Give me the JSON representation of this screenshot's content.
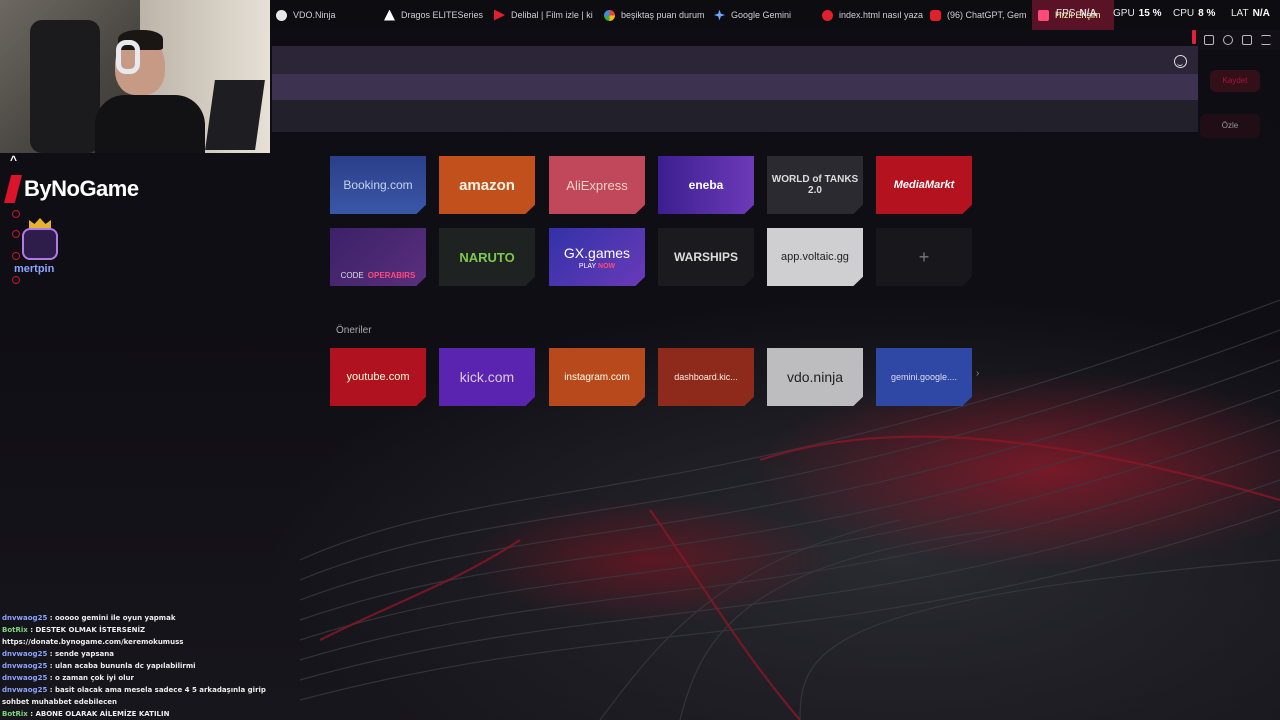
{
  "tabs": [
    {
      "label": "VDO.Ninja",
      "icon": "vdo-ninja-icon",
      "color": "#e8e8e8"
    },
    {
      "label": "Dragos ELITESeries",
      "icon": "triangle-logo-icon",
      "color": "#ffffff"
    },
    {
      "label": "Delibal | Film izle | ki",
      "icon": "play-icon",
      "color": "#e0202d"
    },
    {
      "label": "beşiktaş puan durum",
      "icon": "google-icon",
      "color": "#4285f4"
    },
    {
      "label": "Google Gemini",
      "icon": "gemini-icon",
      "color": "#6ba8ff"
    },
    {
      "label": "index.html nasıl yaza",
      "icon": "chatgpt-icon",
      "color": "#e0202d"
    },
    {
      "label": "(96) ChatGPT, Gem",
      "icon": "youtube-icon",
      "color": "#e0202d"
    },
    {
      "label": "Hızlı Erişim",
      "icon": "grid-icon",
      "color": "#ff4a7a"
    }
  ],
  "hud": {
    "fps_label": "FPS",
    "fps_value": "N/A",
    "gpu_label": "GPU",
    "gpu_value": "15 %",
    "cpu_label": "CPU",
    "cpu_value": "8 %",
    "lat_label": "LAT",
    "lat_value": "N/A"
  },
  "side_buttons": {
    "first": "Kaydet",
    "second": "Özle"
  },
  "speed_dial": {
    "booking": "Booking.com",
    "amazon": "amazon",
    "aliexpress": "AliExpress",
    "eneba": "eneba",
    "wot": "WORLD of TANKS 2.0",
    "mediamarkt": "MediaMarkt",
    "operabirds_code": "CODE",
    "operabirds_brand": "OPERABIRS",
    "greenarena": "NARUTO",
    "gxgames": "GX.games",
    "gxgames_play": "PLAY",
    "gxgames_now": "NOW",
    "warships": "WARSHIPS",
    "voltaic": "app.voltaic.gg",
    "add": "+"
  },
  "suggestions": {
    "heading": "Öneriler",
    "items": [
      "youtube.com",
      "kick.com",
      "instagram.com",
      "dashboard.kic...",
      "vdo.ninja",
      "gemini.google...."
    ]
  },
  "overlay": {
    "brand": "ByNoGame",
    "badge": "mertpin"
  },
  "chat": [
    {
      "user": "dnvwaog25",
      "text": ": ooooo gemini ile oyun yapmak",
      "bot": false
    },
    {
      "user": "BotRix",
      "text": ": DESTEK OLMAK İSTERSENİZ",
      "bot": true
    },
    {
      "user": "",
      "text": "https://donate.bynogame.com/keremokumuss",
      "bot": false
    },
    {
      "user": "dnvwaog25",
      "text": ": sende yapsana",
      "bot": false
    },
    {
      "user": "dnvwaog25",
      "text": ": ulan acaba bununla dc yapılabilirmi",
      "bot": false
    },
    {
      "user": "dnvwaog25",
      "text": ": o zaman çok iyi olur",
      "bot": false
    },
    {
      "user": "dnvwaog25",
      "text": ": basit olacak ama mesela sadece 4 5 arkadaşınla girip",
      "bot": false
    },
    {
      "user": "",
      "text": "sohbet muhabbet edebilecen",
      "bot": false
    },
    {
      "user": "BotRix",
      "text": ": ABONE OLARAK AİLEMİZE KATILIN",
      "bot": true
    }
  ]
}
